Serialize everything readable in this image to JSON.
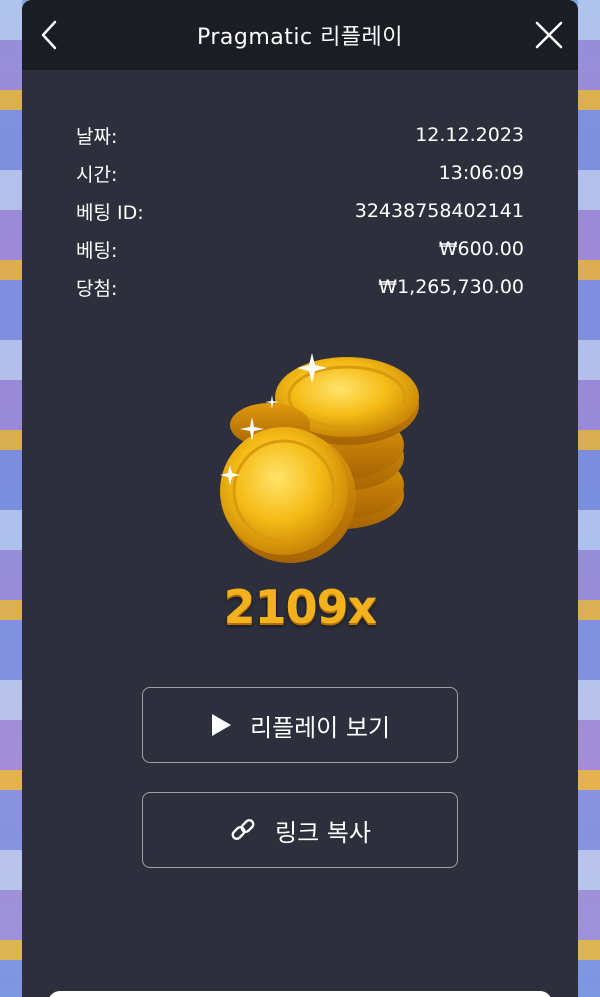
{
  "header": {
    "title": "Pragmatic 리플레이"
  },
  "info": [
    {
      "label": "날짜:",
      "value": "12.12.2023"
    },
    {
      "label": "시간:",
      "value": "13:06:09"
    },
    {
      "label": "베팅 ID:",
      "value": "32438758402141"
    },
    {
      "label": "베팅:",
      "value": "₩600.00"
    },
    {
      "label": "당첨:",
      "value": "₩1,265,730.00"
    }
  ],
  "win": {
    "multiplier": "2109x"
  },
  "buttons": {
    "replay_label": "리플레이 보기",
    "copy_link_label": "링크 복사"
  },
  "icons": {
    "back": "chevron-left-icon",
    "close": "close-icon",
    "play": "play-icon",
    "link": "link-icon",
    "coins": "coin-stack-icon"
  },
  "colors": {
    "header_bg": "#1b1d24",
    "modal_bg": "#2d303c",
    "multiplier": "#f3b21d"
  }
}
